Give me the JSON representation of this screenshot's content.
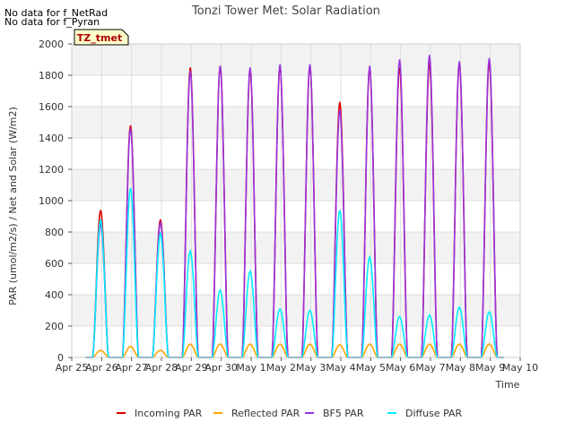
{
  "notes": [
    "No data for f_NetRad",
    "No data for f_Pyran"
  ],
  "chart_data": {
    "type": "line",
    "title": "Tonzi Tower Met: Solar Radiation",
    "xlabel": "Time",
    "ylabel": "PAR (umol/m2/s) / Net and Solar (W/m2)",
    "site_tag": "TZ_tmet",
    "ylim": [
      0,
      2000
    ],
    "yticks": [
      "0",
      "200",
      "400",
      "600",
      "800",
      "1000",
      "1200",
      "1400",
      "1600",
      "1800",
      "2000"
    ],
    "xlim": [
      0,
      15
    ],
    "xticks": [
      "Apr 25",
      "Apr 26",
      "Apr 27",
      "Apr 28",
      "Apr 29",
      "Apr 30",
      "May 1",
      "May 2",
      "May 3",
      "May 4",
      "May 5",
      "May 6",
      "May 7",
      "May 8",
      "May 9",
      "May 10"
    ],
    "grid": true,
    "legend_position": "bottom",
    "series": [
      {
        "name": "Incoming PAR",
        "color": "#dd0000",
        "peaks": [
          940,
          1480,
          880,
          1850,
          1860,
          1840,
          1860,
          1860,
          1630,
          1850,
          1850,
          1880,
          1880,
          1880
        ]
      },
      {
        "name": "Reflected PAR",
        "color": "#ffa500",
        "peaks": [
          45,
          70,
          45,
          85,
          85,
          85,
          85,
          85,
          80,
          85,
          85,
          85,
          85,
          85
        ]
      },
      {
        "name": "BF5 PAR",
        "color": "#9933dd",
        "peaks": [
          850,
          1460,
          860,
          1830,
          1860,
          1850,
          1870,
          1870,
          1580,
          1860,
          1900,
          1930,
          1890,
          1910
        ]
      },
      {
        "name": "Diffuse PAR",
        "color": "#00eeff",
        "peaks": [
          880,
          1080,
          790,
          680,
          430,
          550,
          310,
          300,
          940,
          640,
          260,
          270,
          320,
          290
        ]
      }
    ]
  }
}
